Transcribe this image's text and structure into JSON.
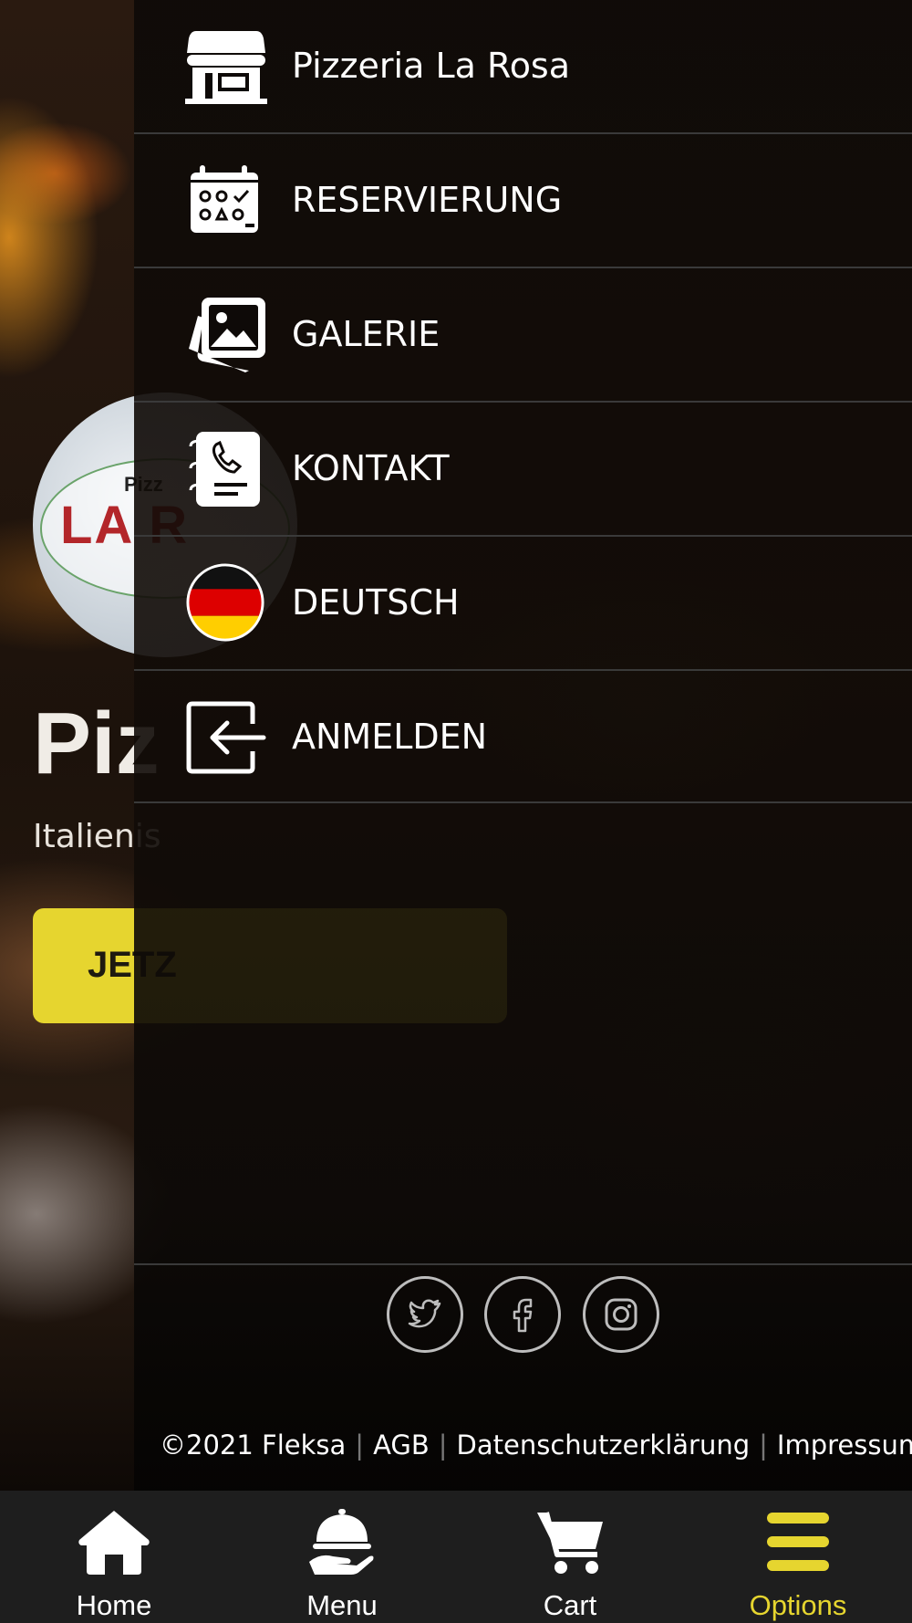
{
  "background": {
    "logo_small_text": "Pizz",
    "logo_big_text": "LA R",
    "heading": "Piz",
    "subtitle": "Italienis",
    "cta_label": "JETZ"
  },
  "drawer": {
    "items": [
      {
        "label": "Pizzeria La Rosa",
        "icon": "store-icon"
      },
      {
        "label": "RESERVIERUNG",
        "icon": "calendar-icon"
      },
      {
        "label": "GALERIE",
        "icon": "gallery-icon"
      },
      {
        "label": "KONTAKT",
        "icon": "contact-book-icon"
      },
      {
        "label": "DEUTSCH",
        "icon": "german-flag-icon"
      },
      {
        "label": "ANMELDEN",
        "icon": "login-icon"
      }
    ],
    "social": [
      "twitter-icon",
      "facebook-icon",
      "instagram-icon"
    ]
  },
  "footer": {
    "copyright": "©2021 Fleksa",
    "agb": "AGB",
    "privacy": "Datenschutzerklärung",
    "imprint": "Impressum"
  },
  "tabbar": {
    "tabs": [
      {
        "label": "Home",
        "icon": "home-icon"
      },
      {
        "label": "Menu",
        "icon": "cloche-icon"
      },
      {
        "label": "Cart",
        "icon": "cart-icon"
      },
      {
        "label": "Options",
        "icon": "hamburger-menu-icon",
        "active": true
      }
    ]
  },
  "colors": {
    "accent": "#e6d52f",
    "tabbar_bg": "#1e1e1e",
    "divider": "#3a3a3a"
  }
}
